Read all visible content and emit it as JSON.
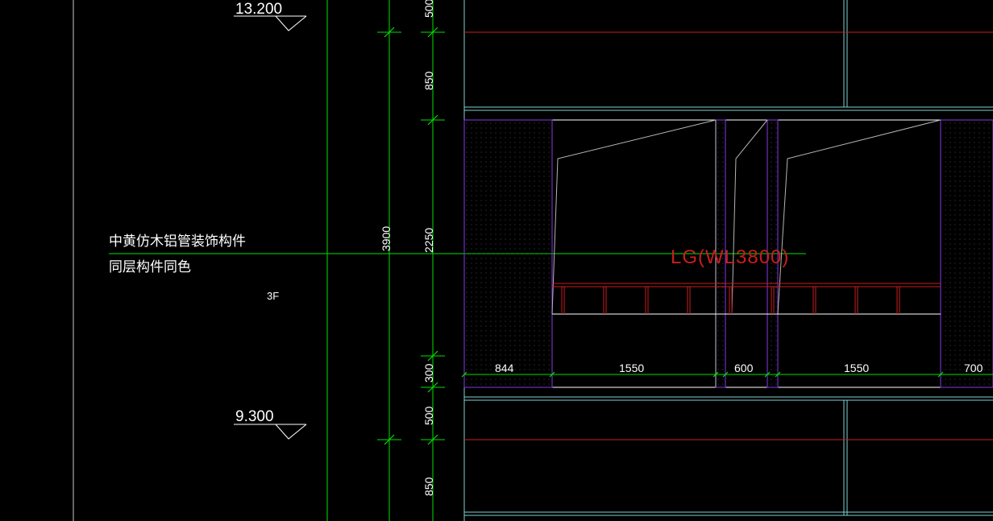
{
  "levels": {
    "upper": "13.200",
    "lower": "9.300"
  },
  "notes": {
    "line1": "中黄仿木铝管装饰构件",
    "line2": "同层构件同色"
  },
  "floor_label": "3F",
  "tag_label": "LG(WL3800)",
  "vertical_dims": {
    "d500_top": "500",
    "d850_top": "850",
    "d2250": "2250",
    "d3900": "3900",
    "d300": "300",
    "d500_bottom": "500",
    "d850_bottom": "850"
  },
  "horizontal_dims": {
    "d844": "844",
    "d1550_a": "1550",
    "d600": "600",
    "d1550_b": "1550",
    "d700": "700"
  },
  "colors": {
    "background": "#000000",
    "dim_green": "#00e000",
    "cyan": "#7fd0d0",
    "red": "#c81e1e",
    "purple": "#7030c0",
    "white": "#ffffff",
    "grey": "#b4b4b4"
  }
}
